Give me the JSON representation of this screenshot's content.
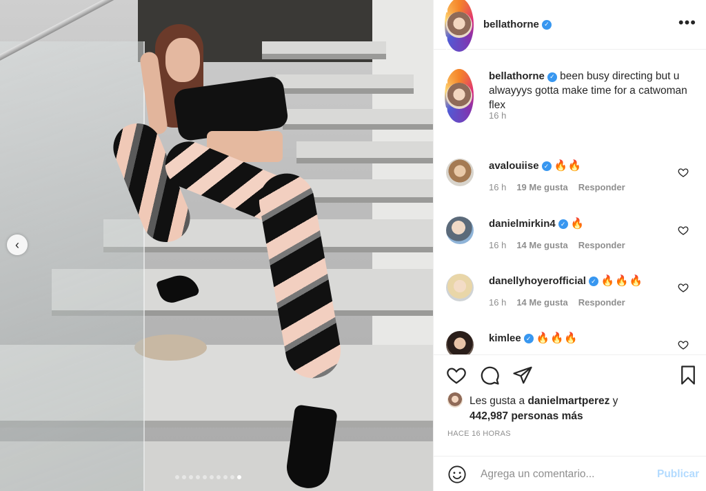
{
  "carousel": {
    "prev_icon": "chevron-left-icon",
    "prev_glyph": "‹",
    "dot_count": 10,
    "active_dot": 10
  },
  "header": {
    "username": "bellathorne",
    "verified_glyph": "✓",
    "more_glyph": "•••"
  },
  "caption": {
    "username": "bellathorne",
    "text": "been busy directing but u alwayyys gotta make time for a catwoman flex",
    "time": "16 h"
  },
  "comments": [
    {
      "username": "avalouiise",
      "text": "🔥🔥",
      "time": "16 h",
      "likes": "19 Me gusta",
      "reply": "Responder"
    },
    {
      "username": "danielmirkin4",
      "text": "🔥",
      "time": "16 h",
      "likes": "14 Me gusta",
      "reply": "Responder"
    },
    {
      "username": "danellyhoyerofficial",
      "text": "🔥🔥🔥",
      "time": "16 h",
      "likes": "14 Me gusta",
      "reply": "Responder"
    },
    {
      "username": "kimlee",
      "text": "🔥🔥🔥"
    }
  ],
  "likes": {
    "prefix": "Les gusta a",
    "user": "danielmartperez",
    "suffix": "y",
    "count": "442,987",
    "count_suffix": "personas más"
  },
  "timestamp": "HACE 16 HORAS",
  "comment_box": {
    "placeholder": "Agrega un comentario...",
    "publish_label": "Publicar"
  },
  "colors": {
    "verified_blue": "#3897f0",
    "publish_disabled": "#b3dbff",
    "text_primary": "#262626",
    "text_secondary": "#8e8e8e"
  }
}
